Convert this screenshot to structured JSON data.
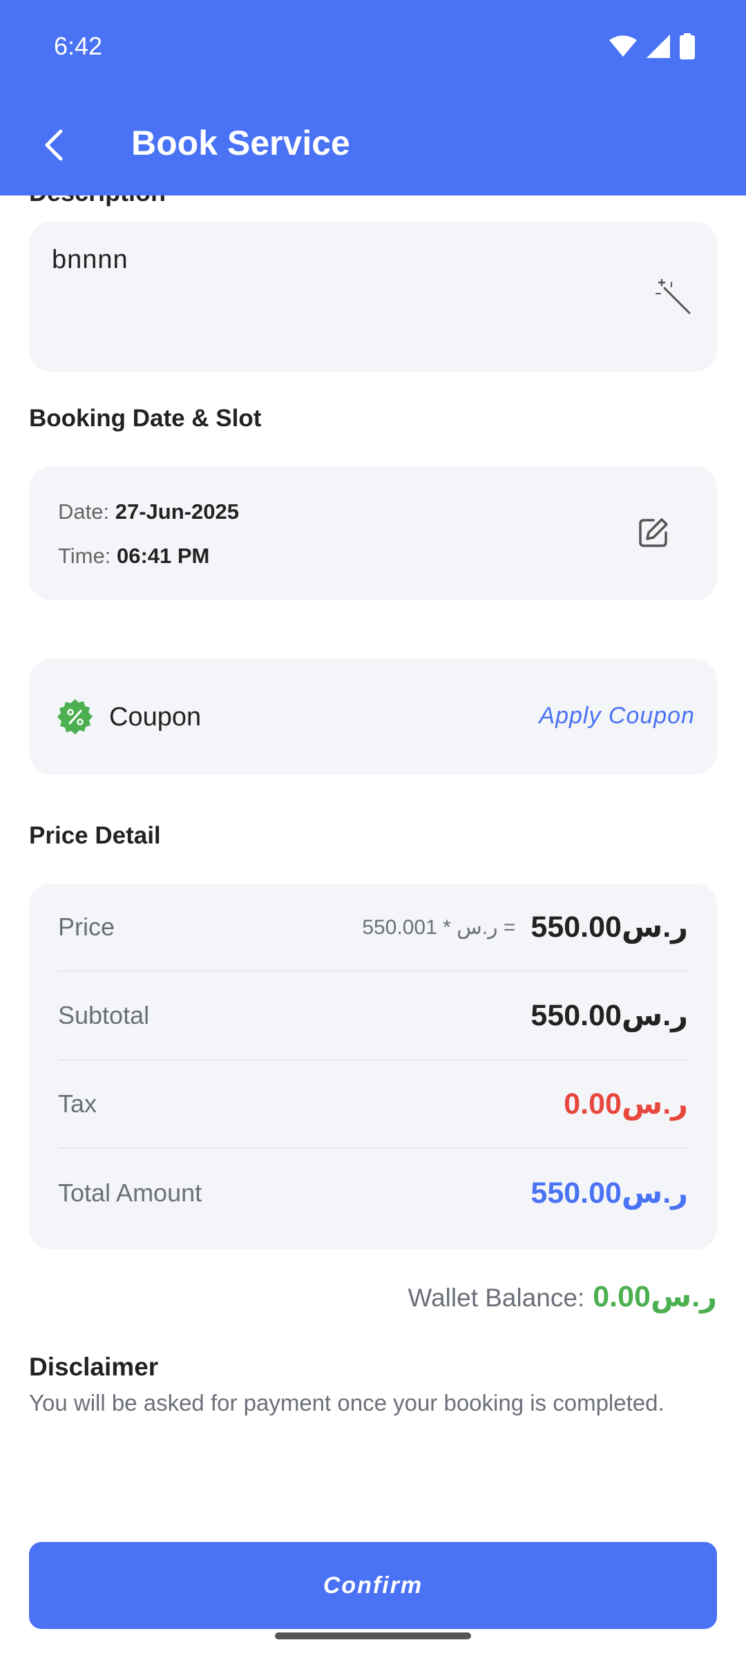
{
  "status_bar": {
    "time": "6:42"
  },
  "app_bar": {
    "title": "Book Service"
  },
  "description": {
    "partial_label": "Description",
    "value": "bnnnn"
  },
  "booking": {
    "section_title": "Booking Date & Slot",
    "date_label": "Date:",
    "date_value": "27-Jun-2025",
    "time_label": "Time:",
    "time_value": "06:41 PM"
  },
  "coupon": {
    "label": "Coupon",
    "action": "Apply Coupon"
  },
  "price_detail": {
    "section_title": "Price Detail",
    "rows": [
      {
        "label": "Price",
        "calc": "550.00ر.س * 1  =",
        "value": "550.00ر.س"
      },
      {
        "label": "Subtotal",
        "value": "550.00ر.س"
      },
      {
        "label": "Tax",
        "value": "0.00ر.س"
      },
      {
        "label": "Total Amount",
        "value": "550.00ر.س"
      }
    ]
  },
  "wallet": {
    "label": "Wallet Balance:",
    "value": "0.00ر.س"
  },
  "disclaimer": {
    "title": "Disclaimer",
    "text": "You will be asked for payment once your booking is completed."
  },
  "confirm": {
    "label": "Confirm"
  },
  "colors": {
    "primary": "#4a72f4",
    "tax_red": "#e8473d",
    "wallet_green": "#4caf50",
    "card_bg": "#f4f5f8"
  },
  "icons": [
    "back-arrow-icon",
    "wifi-icon",
    "signal-icon",
    "battery-icon",
    "magic-wand-icon",
    "edit-icon",
    "percent-badge-icon"
  ]
}
